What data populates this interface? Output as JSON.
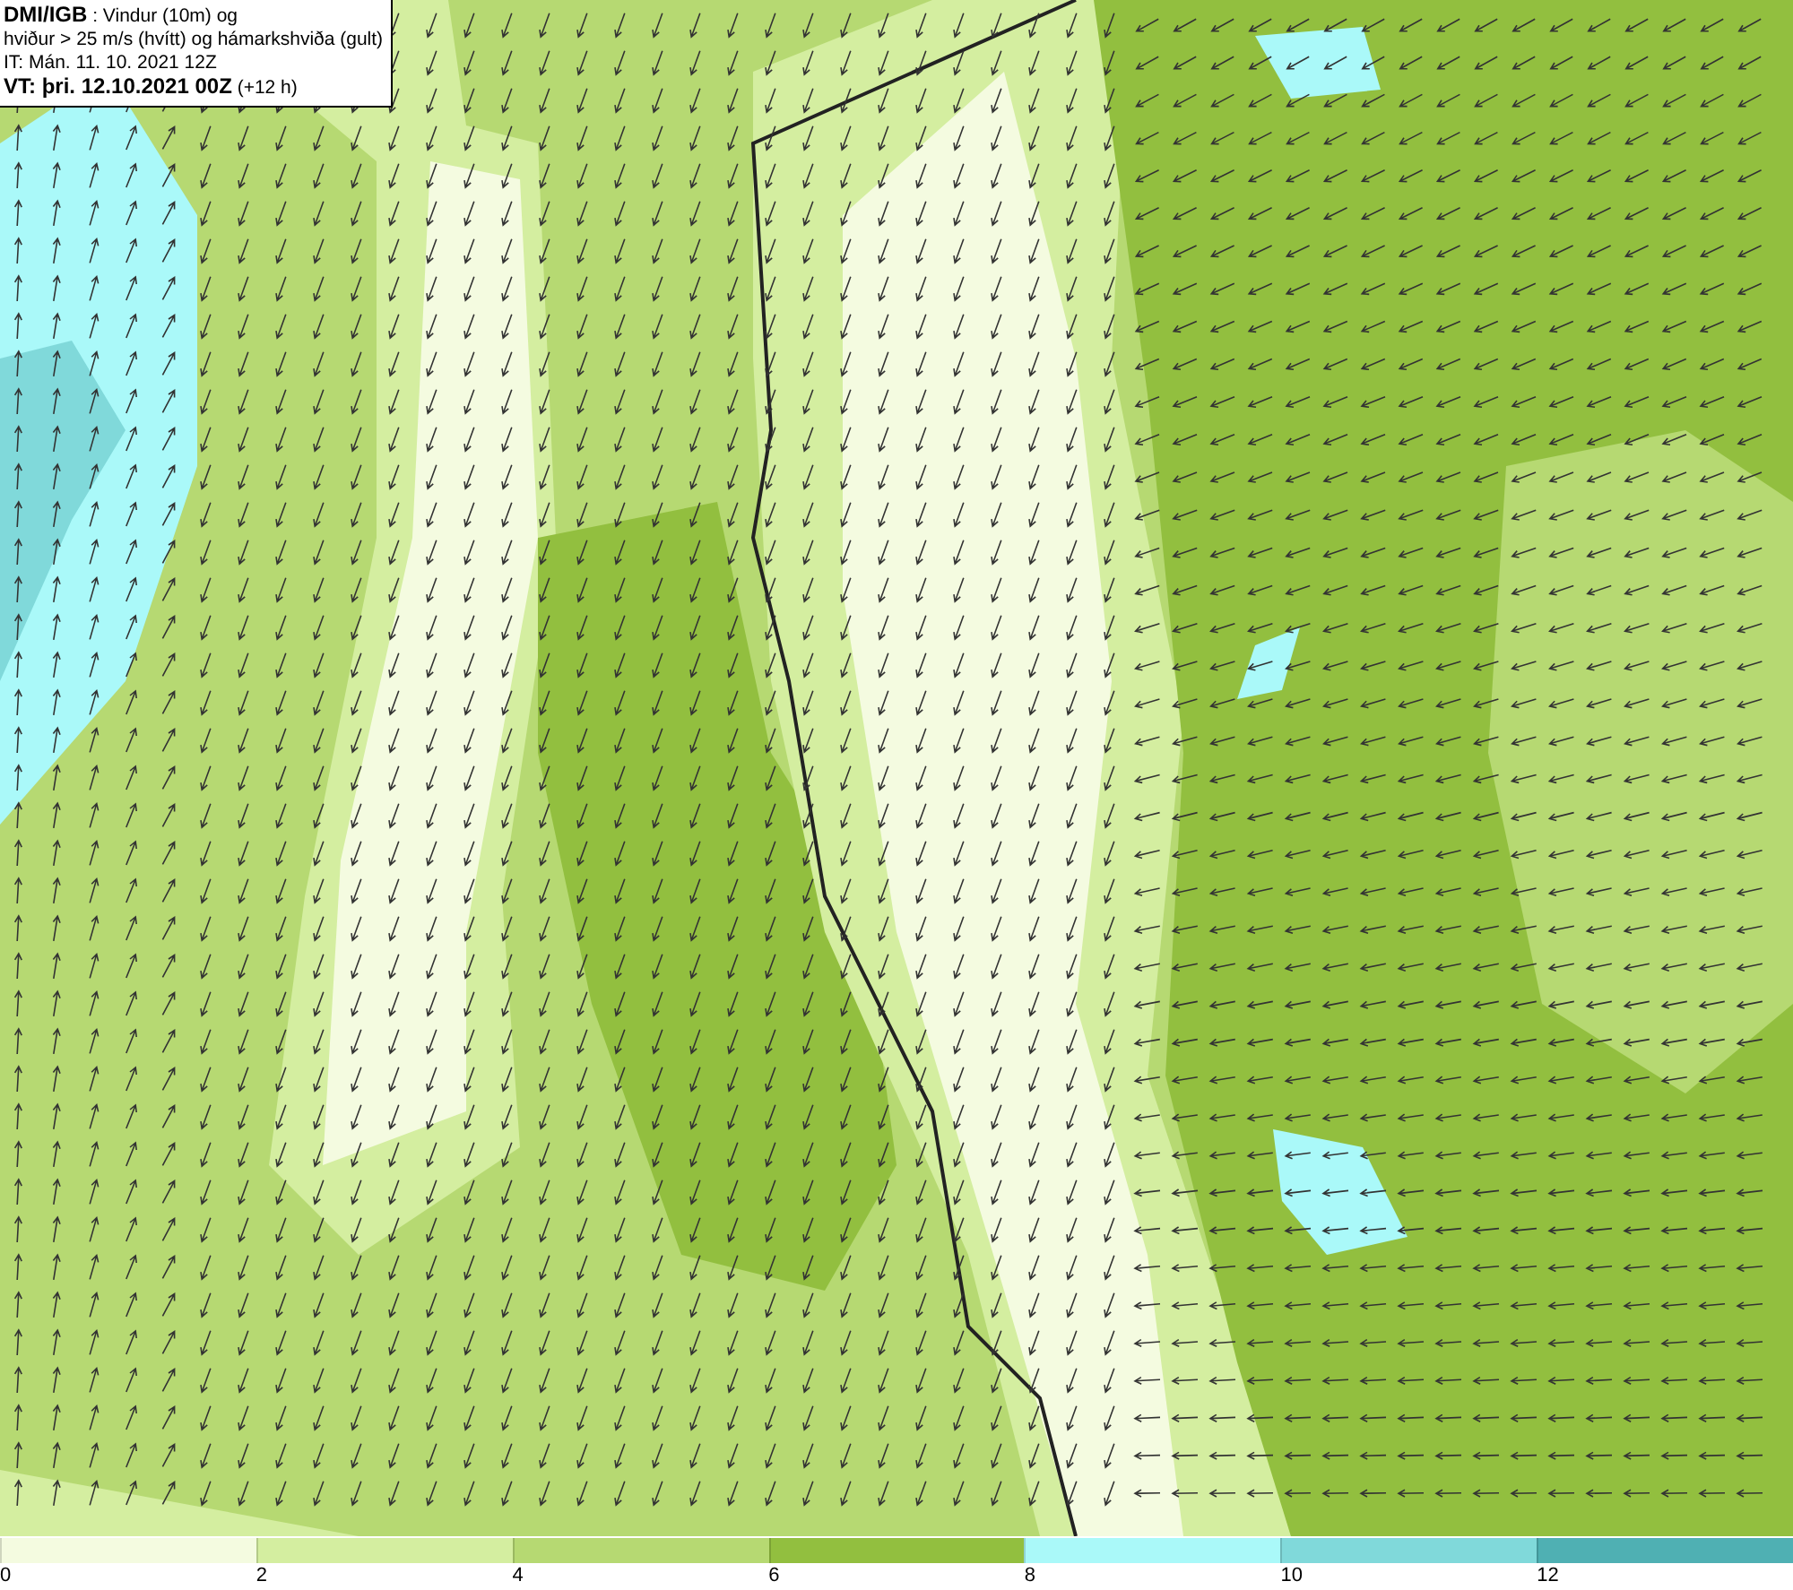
{
  "title_box": {
    "lines": [
      "**DMI/IGB** : Vindur (10m) og",
      "hviður > 25 m/s (hvítt) og hámarkshviða (gult)",
      "IT: Mán. 11. 10. 2021 12Z",
      "**VT: þri. 12.10.2021 00Z** (+12 h)"
    ]
  },
  "legend": {
    "bins": [
      {
        "label": "0",
        "color": "#f4fbe0"
      },
      {
        "label": "2",
        "color": "#d4eea0"
      },
      {
        "label": "4",
        "color": "#b6d972"
      },
      {
        "label": "6",
        "color": "#92bf3f"
      },
      {
        "label": "8",
        "color": "#aaf9f9"
      },
      {
        "label": "10",
        "color": "#80d9da"
      },
      {
        "label": "12",
        "color": "#4fb0b3"
      }
    ]
  }
}
